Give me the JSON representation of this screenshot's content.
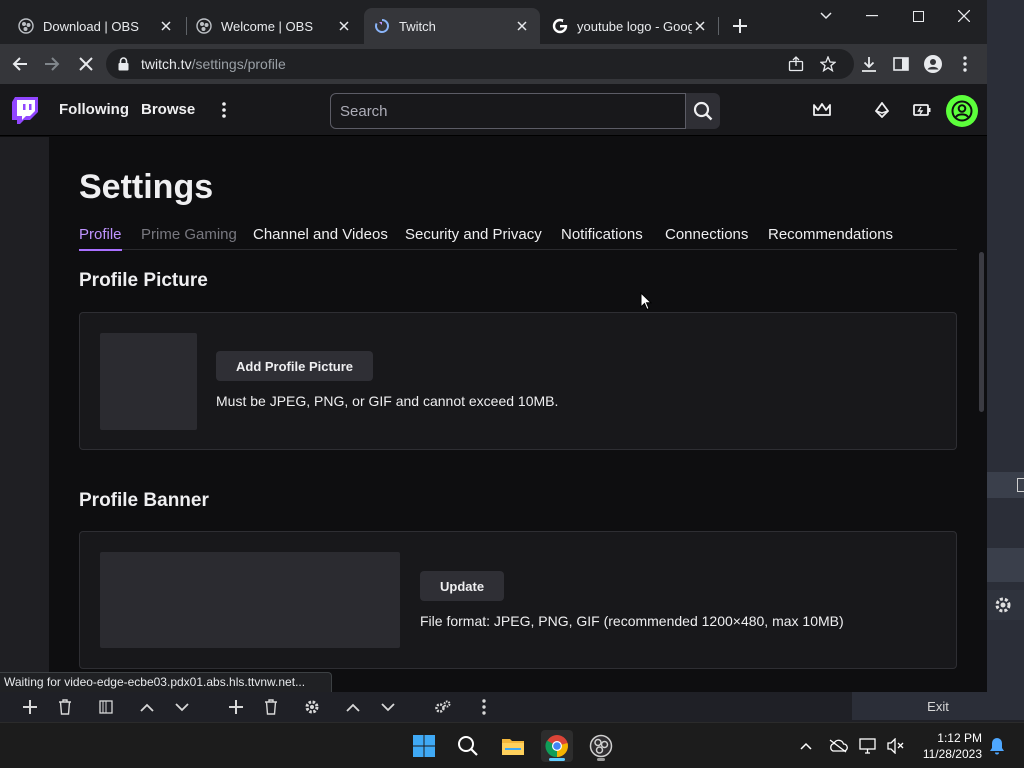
{
  "browser": {
    "tabs": [
      {
        "title": "Download | OBS",
        "icon": "obs-icon"
      },
      {
        "title": "Welcome | OBS",
        "icon": "obs-icon"
      },
      {
        "title": "Twitch",
        "icon": "loading-icon"
      },
      {
        "title": "youtube logo - Goog",
        "icon": "google-icon"
      }
    ],
    "active_tab": 2,
    "url_host": "twitch.tv",
    "url_path": "/settings/profile",
    "status_text": "Waiting for video-edge-ecbe03.pdx01.abs.hls.ttvnw.net..."
  },
  "twitch_nav": {
    "following": "Following",
    "browse": "Browse",
    "search_placeholder": "Search"
  },
  "settings": {
    "title": "Settings",
    "tabs": [
      {
        "label": "Profile",
        "state": "active"
      },
      {
        "label": "Prime Gaming",
        "state": "disabled"
      },
      {
        "label": "Channel and Videos",
        "state": "normal"
      },
      {
        "label": "Security and Privacy",
        "state": "normal"
      },
      {
        "label": "Notifications",
        "state": "normal"
      },
      {
        "label": "Connections",
        "state": "normal"
      },
      {
        "label": "Recommendations",
        "state": "normal"
      }
    ],
    "profile_picture": {
      "title": "Profile Picture",
      "button": "Add Profile Picture",
      "hint": "Must be JPEG, PNG, or GIF and cannot exceed 10MB."
    },
    "profile_banner": {
      "title": "Profile Banner",
      "button": "Update",
      "hint": "File format: JPEG, PNG, GIF (recommended 1200×480, max 10MB)"
    }
  },
  "obs": {
    "exit_label": "Exit"
  },
  "taskbar": {
    "time": "1:12 PM",
    "date": "11/28/2023"
  },
  "colors": {
    "twitch_purple": "#9146ff",
    "active_tab_text": "#bf94ff",
    "avatar_green": "#5cff3b",
    "page_bg": "#0e0e10"
  }
}
